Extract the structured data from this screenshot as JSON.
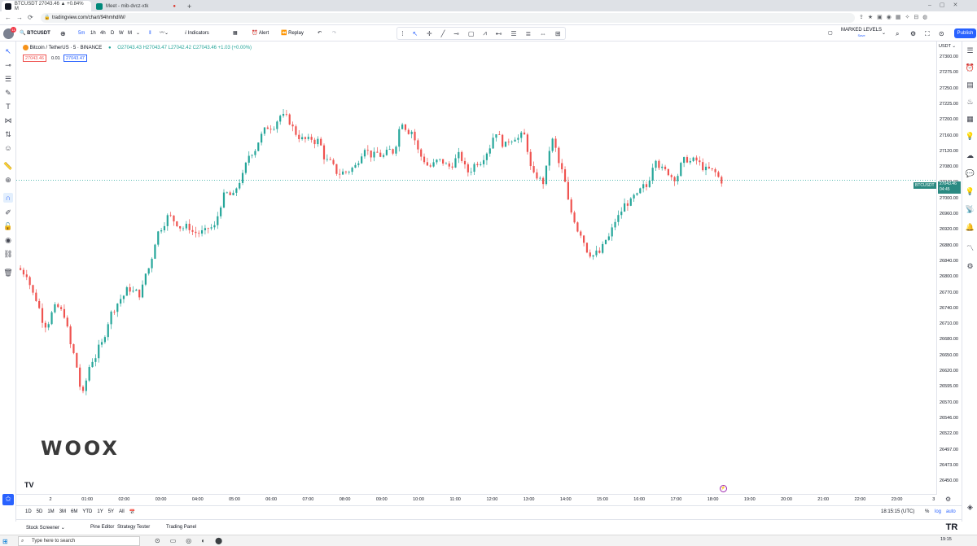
{
  "browser": {
    "tabs": [
      {
        "label": "BTCUSDT 27043.46 ▲ +0.84% M",
        "active": true
      },
      {
        "label": "Meet - mib-dvcz-xtk",
        "active": false
      }
    ],
    "new_tab": "+",
    "url": "tradingview.com/chart/94hmhdlW/"
  },
  "toolbar": {
    "symbol": "BTCUSDT",
    "intervals": [
      "5m",
      "1h",
      "4h",
      "D",
      "W",
      "M"
    ],
    "indicators": "Indicators",
    "alert": "Alert",
    "replay": "Replay",
    "marked_levels": "MARKED LEVELS",
    "marked_sub": "Save",
    "publish": "Publish"
  },
  "legend": {
    "title": "Bitcoin / TetherUS · 5 · BINANCE",
    "ohlc": "O27043.43 H27043.47 L27042.42 C27043.46 +1.03 (+0.00%)",
    "bid": "27043.46",
    "spread": "0.01",
    "ask": "27043.47"
  },
  "price_axis": {
    "currency": "USDT",
    "ticks": [
      "27300.00",
      "27275.00",
      "27250.00",
      "27225.00",
      "27200.00",
      "27160.00",
      "27120.00",
      "27080.00",
      "27040.00",
      "27000.00",
      "26960.00",
      "26920.00",
      "26880.00",
      "26840.00",
      "26800.00",
      "26770.00",
      "26740.00",
      "26710.00",
      "26680.00",
      "26650.00",
      "26620.00",
      "26595.00",
      "26570.00",
      "26546.00",
      "26522.00",
      "26497.00",
      "26473.00",
      "26450.00"
    ],
    "symbol_label": "BTCUSDT",
    "last_price": "27043.46",
    "countdown": "04:45"
  },
  "time_axis": {
    "ticks": [
      "2",
      "01:00",
      "02:00",
      "03:00",
      "04:00",
      "05:00",
      "06:00",
      "07:00",
      "08:00",
      "09:00",
      "10:00",
      "11:00",
      "12:00",
      "13:00",
      "14:00",
      "15:00",
      "16:00",
      "17:00",
      "18:00",
      "19:00",
      "20:00",
      "21:00",
      "22:00",
      "23:00",
      "3"
    ]
  },
  "range_bar": {
    "ranges": [
      "1D",
      "5D",
      "1M",
      "3M",
      "6M",
      "YTD",
      "1Y",
      "5Y",
      "All"
    ],
    "clock": "18:15:15 (UTC)",
    "pct": "%",
    "log": "log",
    "auto": "auto"
  },
  "bottom_panel": {
    "tabs": [
      "Stock Screener",
      "Pine Editor",
      "Strategy Tester",
      "Trading Panel"
    ]
  },
  "watermark": "WOOX",
  "taskbar": {
    "search_placeholder": "Type here to search",
    "time": "19:15"
  },
  "colors": {
    "up": "#26a69a",
    "down": "#ef5350",
    "accent": "#2962ff",
    "label_bg": "#2b8a82"
  },
  "chart_data": {
    "type": "candlestick",
    "symbol": "BTCUSDT",
    "interval": "5",
    "ylim": [
      26440,
      27300
    ],
    "closes": [
      26860,
      26810,
      26760,
      26790,
      26780,
      26700,
      26620,
      26690,
      26720,
      26780,
      26810,
      26830,
      26820,
      26870,
      26940,
      26970,
      26960,
      26950,
      26940,
      26940,
      26950,
      27010,
      27010,
      27050,
      27100,
      27130,
      27150,
      27170,
      27160,
      27130,
      27120,
      27120,
      27080,
      27060,
      27060,
      27070,
      27110,
      27090,
      27090,
      27100,
      27160,
      27140,
      27090,
      27070,
      27080,
      27070,
      27090,
      27060,
      27080,
      27100,
      27140,
      27110,
      27130,
      27130,
      27050,
      27040,
      27120,
      27060,
      26980,
      26940,
      26900,
      26900,
      26930,
      26970,
      27000,
      27010,
      27030,
      27090,
      27060,
      27050,
      27080,
      27080,
      27070,
      27060,
      27043
    ]
  }
}
